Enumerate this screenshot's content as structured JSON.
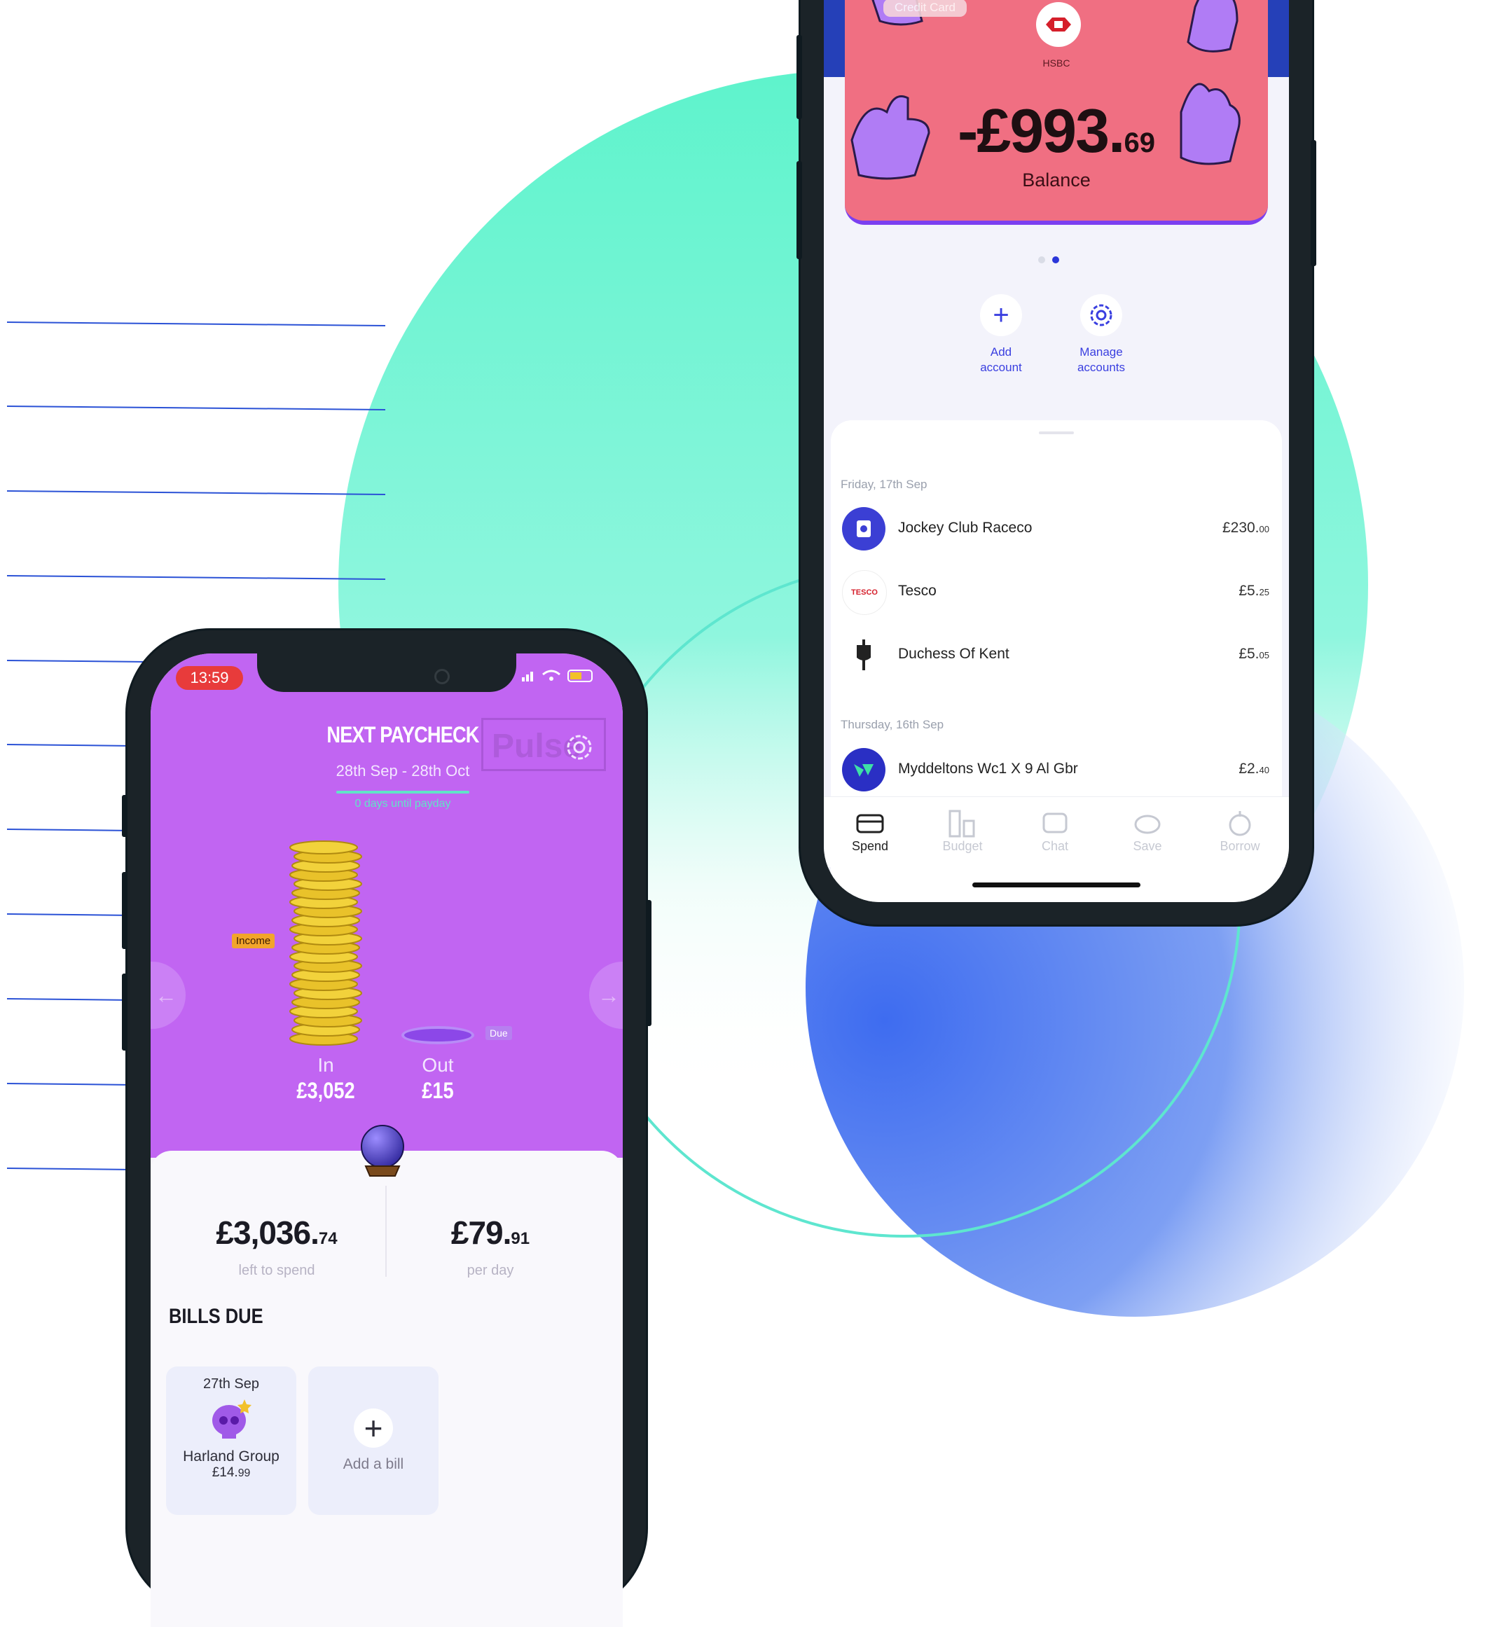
{
  "colors": {
    "mint": "#5ef3cc",
    "blue_gradient": "#3e6cf0",
    "accent_blue": "#2b52d6",
    "purple": "#c165f2",
    "card_pink": "#f06f82"
  },
  "right_phone": {
    "card_tag": "Credit Card",
    "bank_name": "HSBC",
    "balance_main": "-£993.",
    "balance_pence": "69",
    "balance_label": "Balance",
    "actions": [
      {
        "label_line1": "Add",
        "label_line2": "account",
        "icon": "plus-icon"
      },
      {
        "label_line1": "Manage",
        "label_line2": "accounts",
        "icon": "gear-icon"
      }
    ],
    "groups": [
      {
        "date": "Friday, 17th Sep",
        "transactions": [
          {
            "name": "Jockey Club Raceco",
            "amount": "£230.",
            "pence": "00"
          },
          {
            "name": "Tesco",
            "amount": "£5.",
            "pence": "25"
          },
          {
            "name": "Duchess Of Kent",
            "amount": "£5.",
            "pence": "05"
          }
        ]
      },
      {
        "date": "Thursday, 16th Sep",
        "transactions": [
          {
            "name": "Myddeltons Wc1 X 9 Al Gbr",
            "amount": "£2.",
            "pence": "40"
          }
        ]
      }
    ],
    "tabs": [
      {
        "label": "Spend",
        "icon": "card-icon",
        "active": true
      },
      {
        "label": "Budget",
        "icon": "budget-icon",
        "active": false
      },
      {
        "label": "Chat",
        "icon": "chat-icon",
        "active": false
      },
      {
        "label": "Save",
        "icon": "piggy-icon",
        "active": false
      },
      {
        "label": "Borrow",
        "icon": "borrow-icon",
        "active": false
      }
    ],
    "tesco_logo_text": "TESCO"
  },
  "left_phone": {
    "clock": "13:59",
    "watermark": "Pulse",
    "next_paycheck_title": "NEXT PAYCHECK",
    "date_range": "28th Sep - 28th Oct",
    "days_until": "0 days until payday",
    "income_tag": "Income",
    "due_tag": "Due",
    "in_label": "In",
    "in_value": "£3,052",
    "out_label": "Out",
    "out_value": "£15",
    "left_to_spend_main": "£3,036.",
    "left_to_spend_pence": "74",
    "left_to_spend_label": "left to spend",
    "per_day_main": "£79.",
    "per_day_pence": "91",
    "per_day_label": "per day",
    "bills_title": "BILLS DUE",
    "bill": {
      "date": "27th Sep",
      "name": "Harland Group",
      "amount": "£14.",
      "pence": "99"
    },
    "add_bill_label": "Add a bill"
  }
}
